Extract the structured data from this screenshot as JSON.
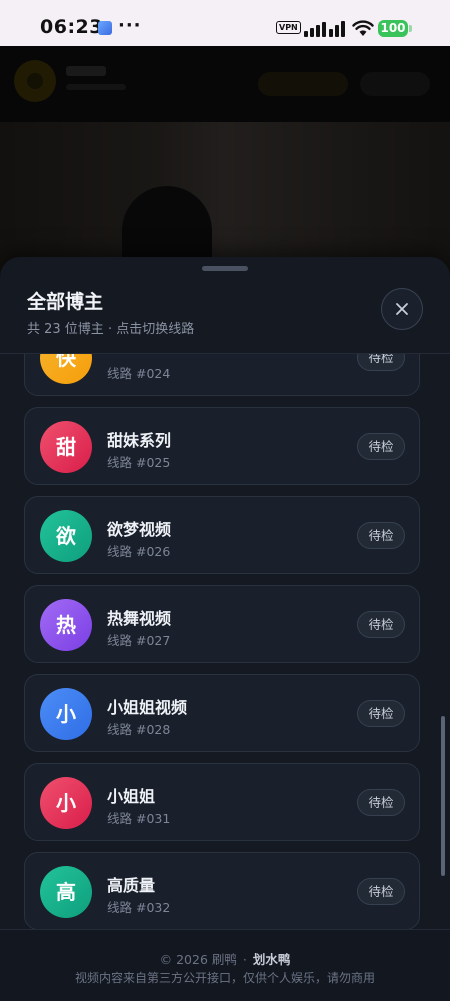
{
  "status_bar": {
    "time": "06:23",
    "more_indicator": "···",
    "vpn_label": "VPN",
    "battery_level": "100",
    "icons": [
      "app-notification-icon",
      "signal-icon",
      "wifi-icon",
      "battery-icon"
    ]
  },
  "sheet": {
    "title": "全部博主",
    "subtitle": "共 23 位博主 · 点击切换线路",
    "close_icon": "close-icon"
  },
  "items": [
    {
      "initial": "快",
      "name": "",
      "route": "线路 #024",
      "status": "待检",
      "color_from": "#f7b42c",
      "color_to": "#f59e0b"
    },
    {
      "initial": "甜",
      "name": "甜妹系列",
      "route": "线路 #025",
      "status": "待检",
      "color_from": "#f0506e",
      "color_to": "#d91e4a"
    },
    {
      "initial": "欲",
      "name": "欲梦视频",
      "route": "线路 #026",
      "status": "待检",
      "color_from": "#22c39a",
      "color_to": "#0f9f7e"
    },
    {
      "initial": "热",
      "name": "热舞视频",
      "route": "线路 #027",
      "status": "待检",
      "color_from": "#a26bf5",
      "color_to": "#7b3fe4"
    },
    {
      "initial": "小",
      "name": "小姐姐视频",
      "route": "线路 #028",
      "status": "待检",
      "color_from": "#4c8df6",
      "color_to": "#2f6ee6"
    },
    {
      "initial": "小",
      "name": "小姐姐",
      "route": "线路 #031",
      "status": "待检",
      "color_from": "#f0506e",
      "color_to": "#d91e4a"
    },
    {
      "initial": "高",
      "name": "高质量",
      "route": "线路 #032",
      "status": "待检",
      "color_from": "#22c39a",
      "color_to": "#0f9f7e"
    }
  ],
  "footer": {
    "copyright": "© 2026 刷鸭",
    "separator": "·",
    "author": "划水鸭",
    "disclaimer": "视频内容来自第三方公开接口，仅供个人娱乐，请勿商用"
  }
}
